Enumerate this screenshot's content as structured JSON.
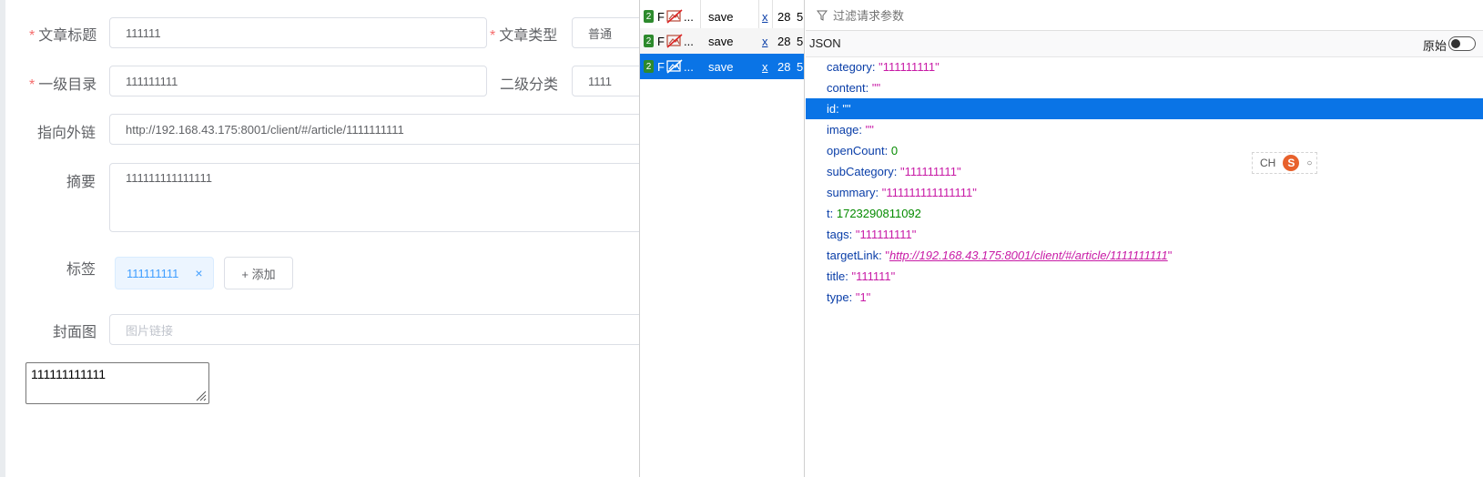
{
  "form": {
    "title_label": "文章标题",
    "title_value": "111111",
    "type_label": "文章类型",
    "type_value": "普通",
    "category_label": "一级目录",
    "category_value": "111111111",
    "subcategory_label": "二级分类",
    "subcategory_value": "1111",
    "link_label": "指向外链",
    "link_value": "http://192.168.43.175:8001/client/#/article/1111111111",
    "summary_label": "摘要",
    "summary_value": "111111111111111",
    "tags_label": "标签",
    "tag_value": "111111111",
    "tag_close": "×",
    "add_tag_label": "+ 添加",
    "cover_label": "封面图",
    "cover_placeholder": "图片链接",
    "required_mark": "*",
    "plain_textarea_value": "111111111111"
  },
  "network": {
    "rows": [
      {
        "status": "2",
        "f": "F",
        "method": "save",
        "x": "x",
        "size": "28",
        "extra": "5",
        "dots": "..."
      },
      {
        "status": "2",
        "f": "F",
        "method": "save",
        "x": "x",
        "size": "28",
        "extra": "5",
        "dots": "..."
      },
      {
        "status": "2",
        "f": "F",
        "method": "save",
        "x": "x",
        "size": "28",
        "extra": "5",
        "dots": "..."
      }
    ]
  },
  "panel": {
    "filter_placeholder": "过滤请求参数",
    "json_title": "JSON",
    "raw_label": "原始",
    "fields": [
      {
        "key": "category:",
        "open": "\"",
        "value": "111111111",
        "close": "\""
      },
      {
        "key": "content:",
        "open": "\"",
        "value": "",
        "close": "\""
      },
      {
        "key": "id:",
        "open": "\"",
        "value": "",
        "close": "\""
      },
      {
        "key": "image:",
        "open": "\"",
        "value": "",
        "close": "\""
      },
      {
        "key": "openCount:",
        "number": "0"
      },
      {
        "key": "subCategory:",
        "open": "\"",
        "value": "111111111",
        "close": "\""
      },
      {
        "key": "summary:",
        "open": "\"",
        "value": "111111111111111",
        "close": "\""
      },
      {
        "key": "t:",
        "number": "1723290811092"
      },
      {
        "key": "tags:",
        "open": "\"",
        "value": "111111111",
        "close": "\""
      },
      {
        "key": "targetLink:",
        "open": "\"",
        "link": "http://192.168.43.175:8001/client/#/article/1111111111",
        "close": "\""
      },
      {
        "key": "title:",
        "open": "\"",
        "value": "111111",
        "close": "\""
      },
      {
        "key": "type:",
        "open": "\"",
        "value": "1",
        "close": "\""
      }
    ]
  },
  "ime": {
    "label": "CH",
    "logo": "S"
  },
  "colors": {
    "accent": "#0a74e6",
    "string": "#c81ba6",
    "number": "#058b00",
    "key": "#0a3ea8",
    "required": "#f56c6c",
    "tag": "#409eff"
  }
}
